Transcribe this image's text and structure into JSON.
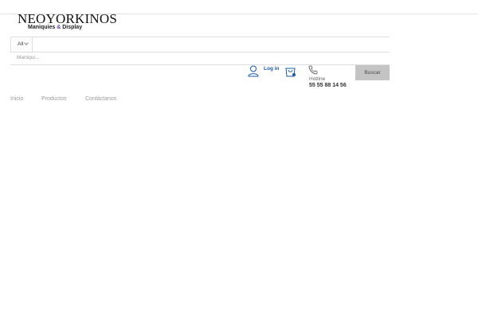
{
  "header": {
    "logo_title": "NEOYORKINOS",
    "logo_sub_before": "Maniquies ",
    "logo_sub_amp": "&",
    "logo_sub_after": " Display"
  },
  "search": {
    "category_selected": "All",
    "placeholder": "Maniqui...",
    "button_label": "Buscar"
  },
  "account": {
    "login_label": "Log in",
    "user_icon": "user-icon",
    "cart_icon": "shopping-bag-icon"
  },
  "hotline": {
    "icon": "phone-icon",
    "label": "Hotline",
    "number": "55 55 88 14 56"
  },
  "nav": {
    "items": [
      "Inicio",
      "Productos",
      "Contáctanos"
    ]
  },
  "colors": {
    "accent_link": "#1a5aa8",
    "brand_amp": "#6a3fa0",
    "button_bg": "#c4c4c4"
  }
}
